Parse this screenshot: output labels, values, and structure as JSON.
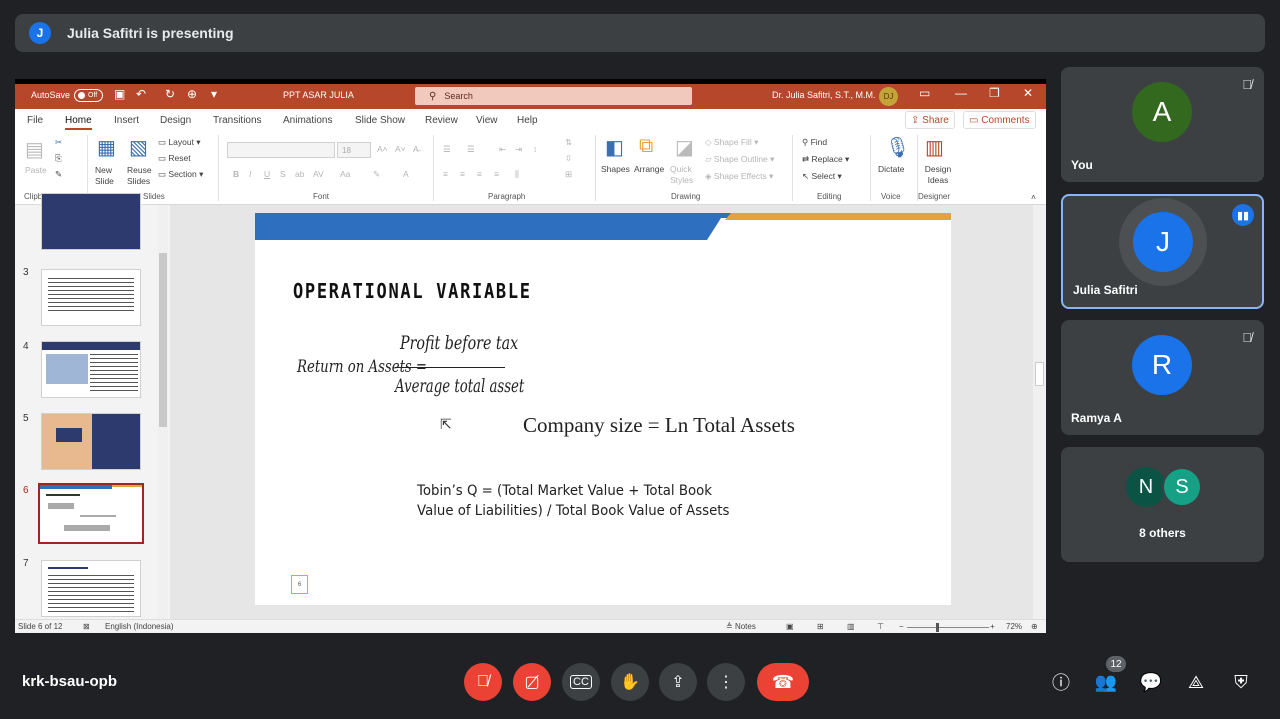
{
  "presenting": {
    "avatar_letter": "J",
    "text": "Julia Safitri is presenting"
  },
  "ppt": {
    "autosave_label": "AutoSave",
    "autosave_state": "Off",
    "doc_title": "PPT ASAR JULIA",
    "search_placeholder": "Search",
    "user_name": "Dr. Julia Safitri, S.T., M.M.",
    "user_initials": "DJ",
    "tabs": [
      "File",
      "Home",
      "Insert",
      "Design",
      "Transitions",
      "Animations",
      "Slide Show",
      "Review",
      "View",
      "Help"
    ],
    "active_tab": "Home",
    "share_label": "Share",
    "comments_label": "Comments",
    "ribbon": {
      "clipboard": {
        "paste": "Paste",
        "label": "Clipboard"
      },
      "slides": {
        "new_slide": "New Slide",
        "reuse_slides": "Reuse Slides",
        "layout": "Layout",
        "reset": "Reset",
        "section": "Section",
        "label": "Slides"
      },
      "font": {
        "size": "18",
        "label": "Font"
      },
      "paragraph": {
        "label": "Paragraph"
      },
      "drawing": {
        "shapes": "Shapes",
        "arrange": "Arrange",
        "quick_styles": "Quick Styles",
        "shape_fill": "Shape Fill",
        "shape_outline": "Shape Outline",
        "shape_effects": "Shape Effects",
        "label": "Drawing"
      },
      "editing": {
        "find": "Find",
        "replace": "Replace",
        "select": "Select",
        "label": "Editing"
      },
      "voice": {
        "dictate": "Dictate",
        "label": "Voice"
      },
      "designer": {
        "design_ideas": "Design Ideas",
        "label": "Designer"
      }
    },
    "thumbnails": [
      {
        "num": "3"
      },
      {
        "num": "4"
      },
      {
        "num": "5"
      },
      {
        "num": "6",
        "selected": true
      },
      {
        "num": "7"
      }
    ],
    "slide": {
      "title": "OPERATIONAL VARIABLE",
      "formula_lhs": "Return on Assets =",
      "formula_num": "Profit before tax",
      "formula_den": "Average total asset",
      "company_size": "Company size = Ln Total Assets",
      "tobin_line1": "Tobin’s Q = (Total Market Value + Total Book",
      "tobin_line2": "Value of Liabilities) / Total Book Value of Assets",
      "page_num": "6"
    },
    "status": {
      "slide_of": "Slide 6 of 12",
      "language": "English (Indonesia)",
      "notes": "Notes",
      "zoom": "72%"
    }
  },
  "participants": [
    {
      "letter": "A",
      "name": "You",
      "color": "#33691e"
    },
    {
      "letter": "J",
      "name": "Julia Safitri",
      "color": "#1a73e8"
    },
    {
      "letter": "R",
      "name": "Ramya A",
      "color": "#1a73e8"
    }
  ],
  "others": {
    "a": "N",
    "b": "S",
    "label": "8 others"
  },
  "meeting_code": "krk-bsau-opb",
  "people_count": "12"
}
